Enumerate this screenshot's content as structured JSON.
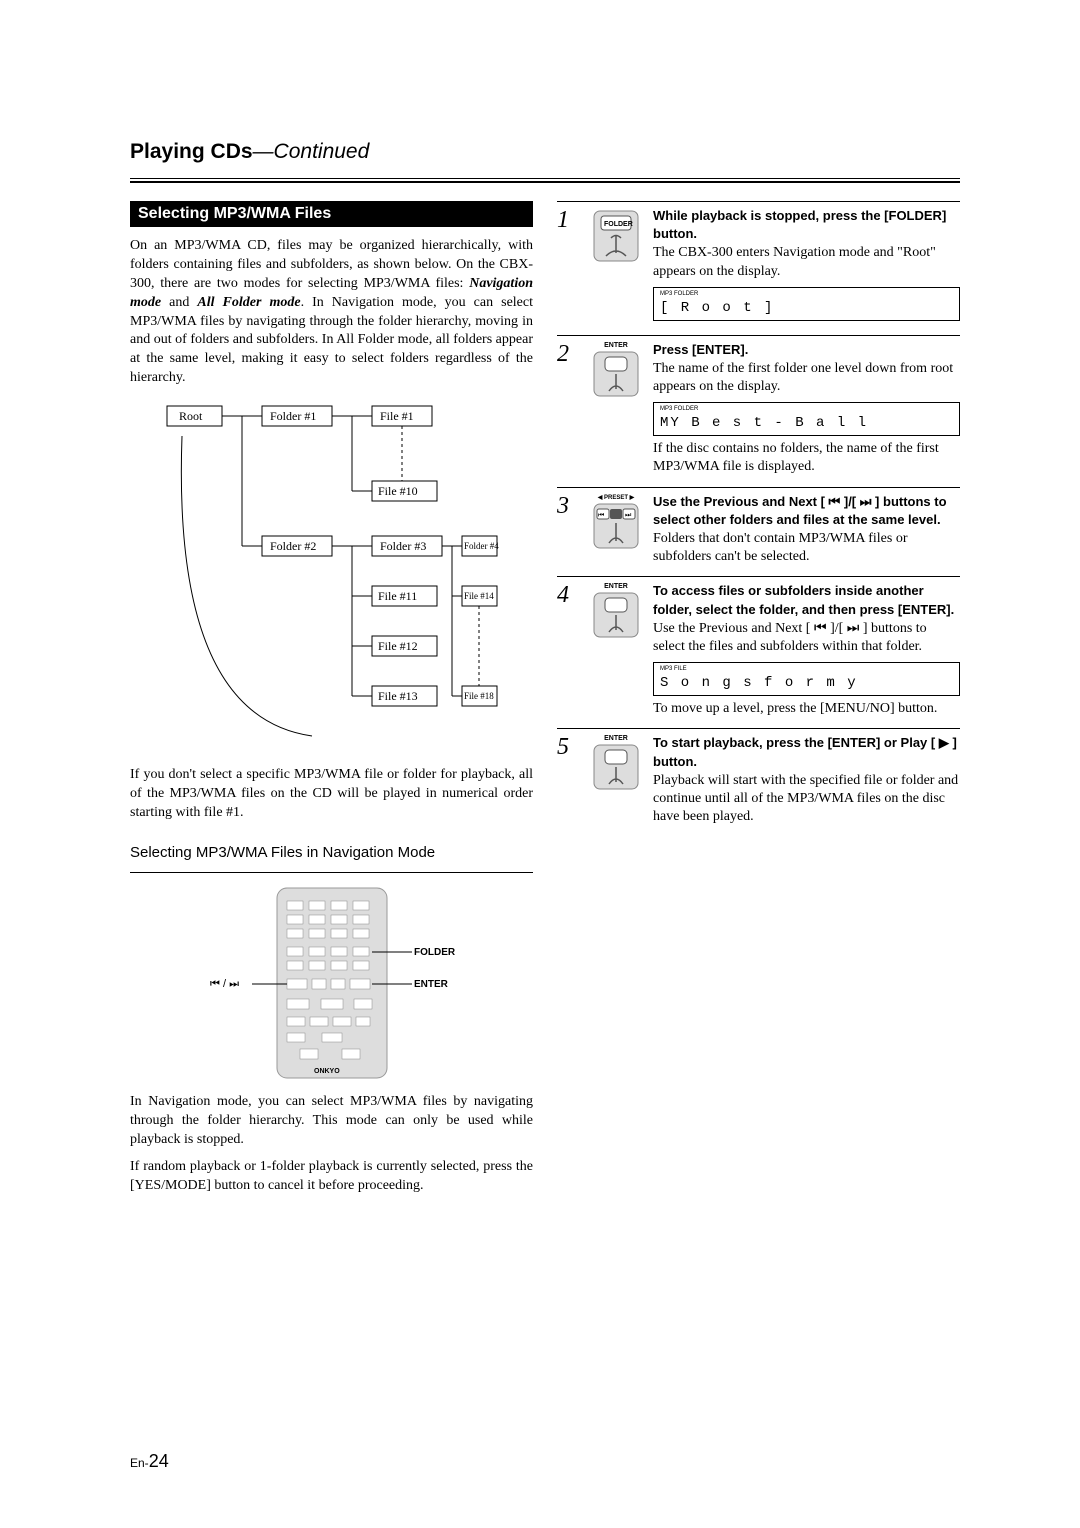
{
  "header": {
    "title": "Playing CDs",
    "continued": "—Continued"
  },
  "left": {
    "reverse_heading": "Selecting MP3/WMA Files",
    "intro_html": "On an MP3/WMA CD, files may be organized hierarchically, with folders containing files and subfolders, as shown below. On the CBX-300, there are two modes for selecting MP3/WMA files: Navigation mode and All Folder mode. In Navigation mode, you can select MP3/WMA files by navigating through the folder hierarchy, moving in and out of folders and subfolders. In All Folder mode, all folders appear at the same level, making it easy to select folders regardless of the hierarchy.",
    "tree": {
      "root": "Root",
      "folder1": "Folder #1",
      "folder2": "Folder #2",
      "folder3": "Folder #3",
      "folder4": "Folder #4",
      "file1": "File #1",
      "file10": "File #10",
      "file11": "File #11",
      "file12": "File #12",
      "file13": "File #13",
      "file14": "File #14",
      "file18": "File #18"
    },
    "post_tree": "If you don't select a specific MP3/WMA file or folder for playback, all of the MP3/WMA files on the CD will be played in numerical order starting with file #1.",
    "subheading": "Selecting MP3/WMA Files in Navigation Mode",
    "remote_labels": {
      "prev_next_icon": "⏮ / ⏭",
      "folder_label": "FOLDER",
      "enter_label": "ENTER"
    },
    "nav_p1": "In Navigation mode, you can select MP3/WMA files by navigating through the folder hierarchy. This mode can only be used while playback is stopped.",
    "nav_p2": "If random playback or 1-folder playback is currently selected, press the [YES/MODE] button to cancel it before proceeding."
  },
  "steps": [
    {
      "num": "1",
      "icon_label": "FOLDER",
      "bold": "While playback is stopped, press the [FOLDER] button.",
      "body": "The CBX-300 enters Navigation mode and \"Root\" appears on the display.",
      "display_tiny": "MP3   FOLDER",
      "display": "[   R o o t   ]"
    },
    {
      "num": "2",
      "icon_label": "ENTER",
      "bold": "Press [ENTER].",
      "body": "The name of the first folder one level down from root appears on the display.",
      "display_tiny": "MP3   FOLDER",
      "display": "MY   B e s t - B a l l",
      "after": "If the disc contains no folders, the name of the first MP3/WMA file is displayed."
    },
    {
      "num": "3",
      "icon_label": "◀ PRESET ▶\n⏮ ▮ ⏭",
      "bold": "Use the Previous and Next [ ⏮ ]/[ ⏭ ] buttons to select other folders and files at the same level.",
      "body": "Folders that don't contain MP3/WMA files or subfolders can't be selected."
    },
    {
      "num": "4",
      "icon_label": "ENTER",
      "bold": "To access files or subfolders inside another folder, select the folder, and then press [ENTER].",
      "body": "Use the Previous and Next [ ⏮ ]/[ ⏭ ] buttons to select the files and subfolders within that folder.",
      "display_tiny": "MP3            FILE",
      "display": "S o n g s   f o r   m y",
      "after": "To move up a level, press the [MENU/NO] button."
    },
    {
      "num": "5",
      "icon_label": "ENTER",
      "bold": "To start playback, press the [ENTER] or Play [ ▶ ] button.",
      "body": "Playback will start with the specified file or folder and continue until all of the MP3/WMA files on the disc have been played."
    }
  ],
  "page_number": {
    "prefix": "En-",
    "num": "24"
  }
}
